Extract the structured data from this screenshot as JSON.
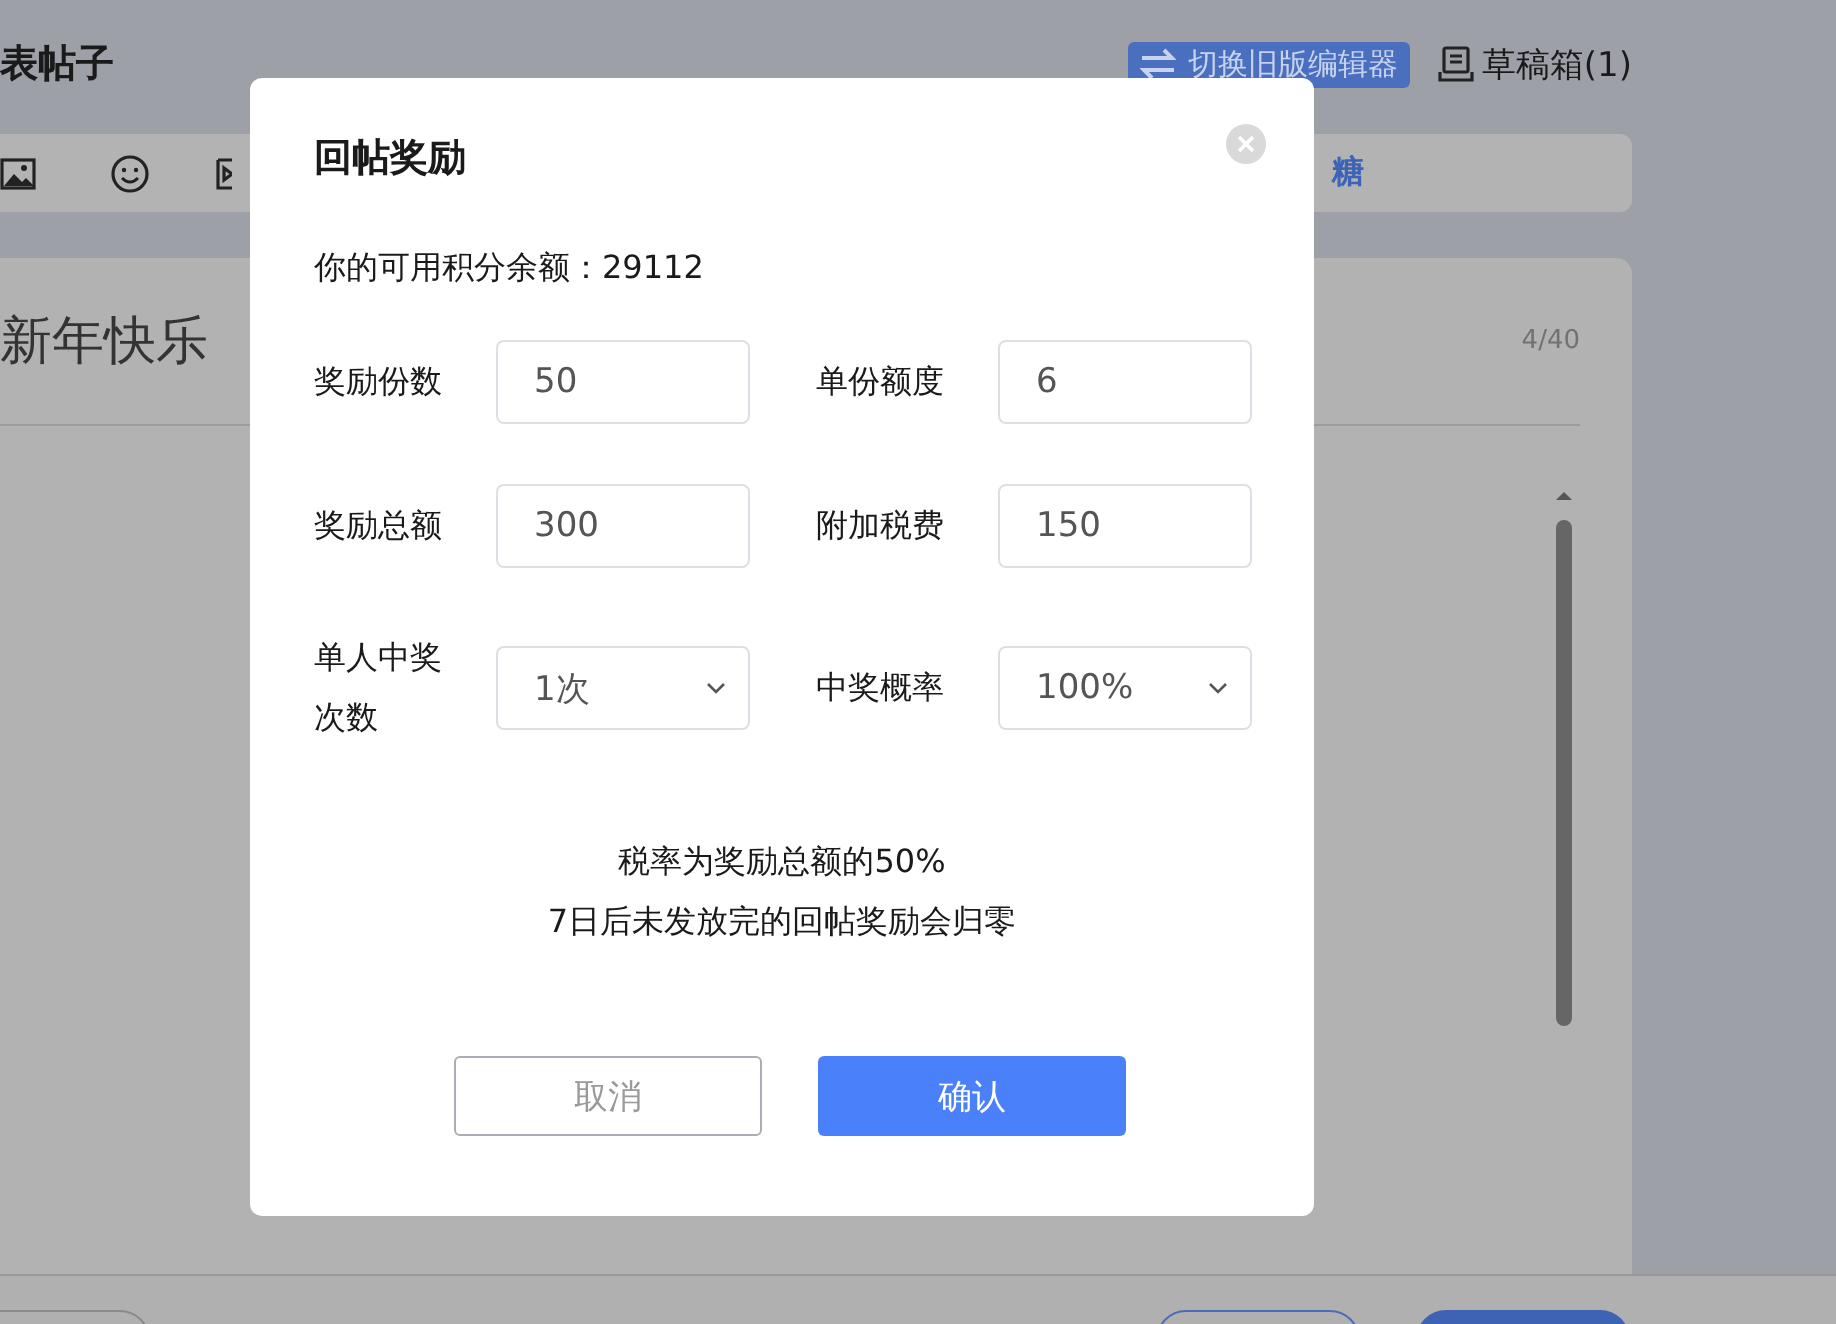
{
  "page": {
    "title": "表帖子",
    "switch_editor": "切换旧版编辑器",
    "drafts": "草稿箱(1)"
  },
  "toolbar": {
    "text_item": "糖"
  },
  "editor": {
    "post_title": "新年快乐",
    "title_count": "4/40"
  },
  "dialog": {
    "title": "回帖奖励",
    "balance": "你的可用积分余额：29112",
    "fields": [
      {
        "kind": "input",
        "label": "奖励份数",
        "value": "50"
      },
      {
        "kind": "input",
        "label": "单份额度",
        "value": "6"
      },
      {
        "kind": "input",
        "label": "奖励总额",
        "value": "300"
      },
      {
        "kind": "input",
        "label": "附加税费",
        "value": "150"
      },
      {
        "kind": "select",
        "label": "单人中奖次数",
        "value": "1次"
      },
      {
        "kind": "select",
        "label": "中奖概率",
        "value": "100%"
      }
    ],
    "notes": [
      "税率为奖励总额的50%",
      "7日后未发放完的回帖奖励会归零"
    ],
    "buttons": [
      {
        "kind": "secondary",
        "label": "取消"
      },
      {
        "kind": "primary",
        "label": "确认"
      }
    ]
  }
}
